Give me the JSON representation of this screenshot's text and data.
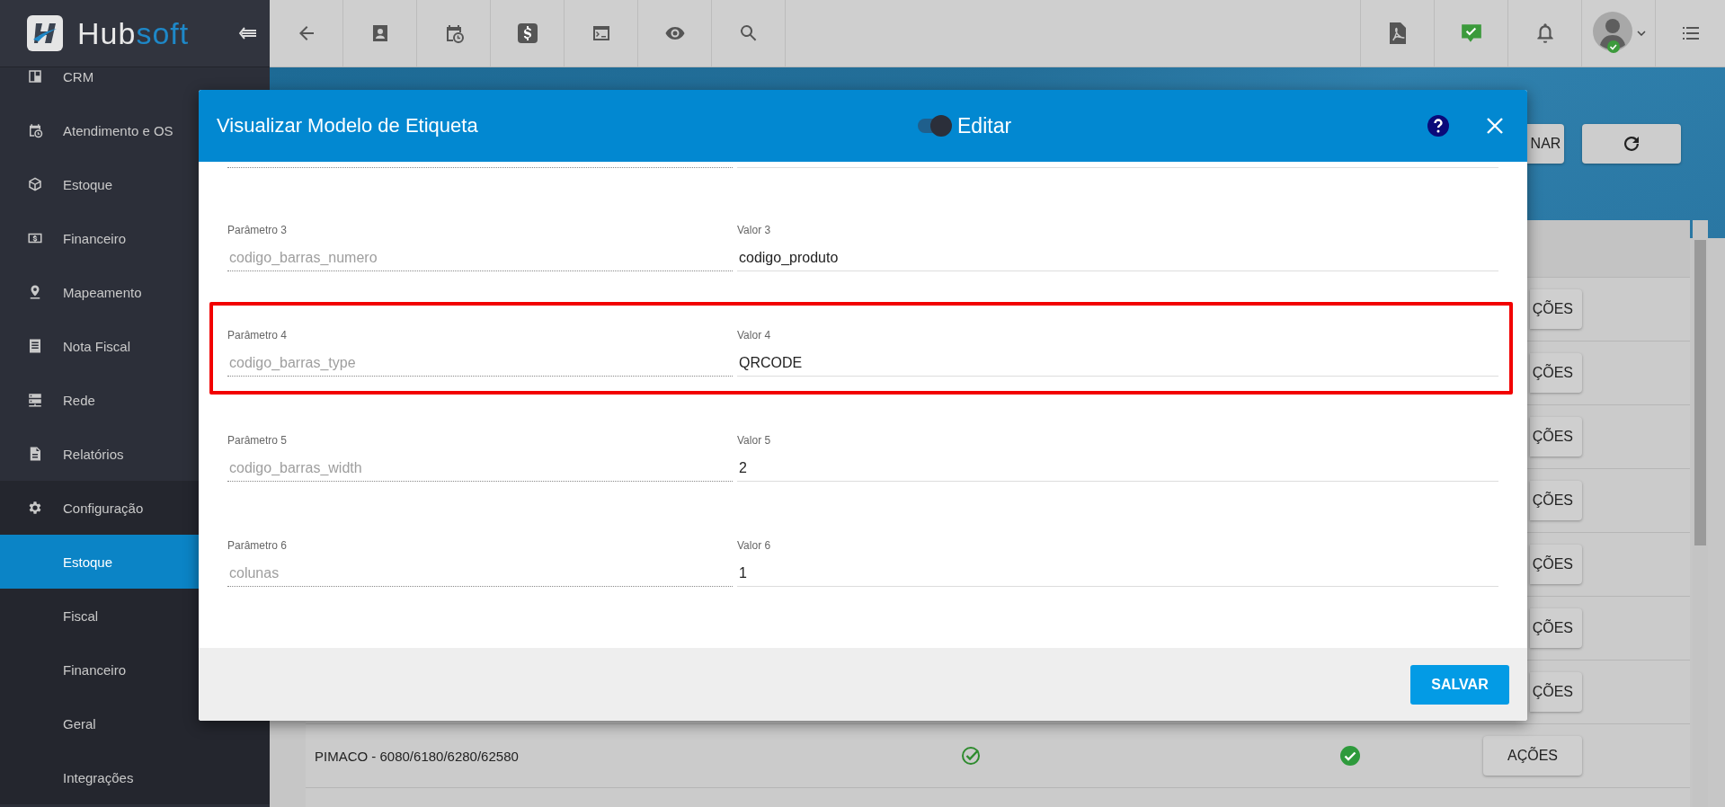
{
  "logo": {
    "first": "Hub",
    "second": "soft"
  },
  "sidebar": {
    "items": [
      {
        "label": "CRM",
        "selected": false
      },
      {
        "label": "Atendimento e OS",
        "selected": false
      },
      {
        "label": "Estoque",
        "selected": false
      },
      {
        "label": "Financeiro",
        "selected": false
      },
      {
        "label": "Mapeamento",
        "selected": false
      },
      {
        "label": "Nota Fiscal",
        "selected": false
      },
      {
        "label": "Rede",
        "selected": false
      },
      {
        "label": "Relatórios",
        "selected": false
      },
      {
        "label": "Configuração",
        "selected": false,
        "expanded": true,
        "children": [
          {
            "label": "Estoque",
            "selected": true
          },
          {
            "label": "Fiscal",
            "selected": false
          },
          {
            "label": "Financeiro",
            "selected": false
          },
          {
            "label": "Geral",
            "selected": false
          },
          {
            "label": "Integrações",
            "selected": false
          }
        ]
      }
    ]
  },
  "page": {
    "header_button": "NAR",
    "rows": [
      {
        "kind": "covered",
        "action": "ÇÕES"
      },
      {
        "kind": "covered",
        "action": "ÇÕES"
      },
      {
        "kind": "covered",
        "action": "ÇÕES"
      },
      {
        "kind": "covered",
        "action": "ÇÕES"
      },
      {
        "kind": "covered",
        "action": "ÇÕES"
      },
      {
        "kind": "covered",
        "action": "ÇÕES"
      },
      {
        "kind": "covered",
        "action": "ÇÕES"
      },
      {
        "kind": "full",
        "name": "PIMACO - 6080/6180/6280/62580",
        "action": "AÇÕES"
      }
    ]
  },
  "modal": {
    "title": "Visualizar Modelo de Etiqueta",
    "toggle": {
      "label": "Editar",
      "on": true
    },
    "fields": [
      {
        "highlighted": false,
        "param": {
          "label": "Parâmetro 3",
          "value": "codigo_barras_numero",
          "disabled": true
        },
        "valor": {
          "label": "Valor 3",
          "value": "codigo_produto",
          "disabled": false
        }
      },
      {
        "highlighted": true,
        "param": {
          "label": "Parâmetro 4",
          "value": "codigo_barras_type",
          "disabled": true
        },
        "valor": {
          "label": "Valor 4",
          "value": "QRCODE",
          "disabled": false
        }
      },
      {
        "highlighted": false,
        "param": {
          "label": "Parâmetro 5",
          "value": "codigo_barras_width",
          "disabled": true
        },
        "valor": {
          "label": "Valor 5",
          "value": "2",
          "disabled": false
        }
      },
      {
        "highlighted": false,
        "param": {
          "label": "Parâmetro 6",
          "value": "colunas",
          "disabled": true
        },
        "valor": {
          "label": "Valor 6",
          "value": "1",
          "disabled": false
        }
      }
    ],
    "save_button": "SALVAR"
  }
}
